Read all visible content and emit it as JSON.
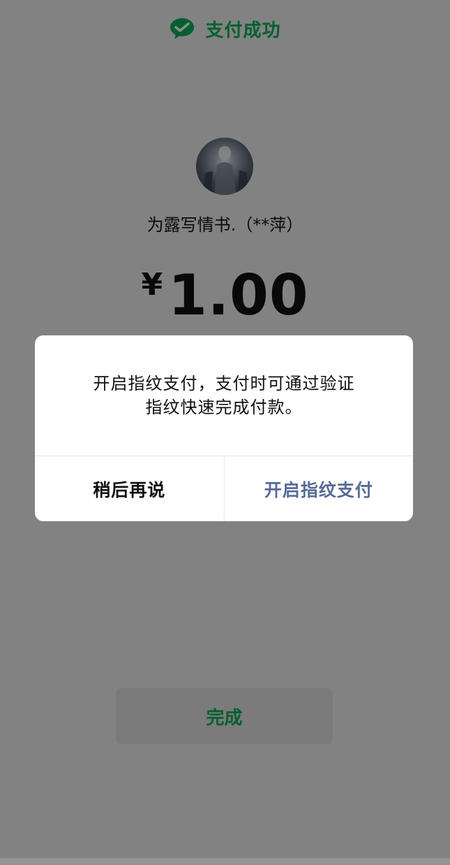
{
  "header": {
    "title": "支付成功",
    "icon": "wechat-logo-icon",
    "brand_color": "#06ae56"
  },
  "payment": {
    "payee": "为露写情书.（**萍）",
    "currency": "¥",
    "amount": "1.00"
  },
  "done_button": {
    "label": "完成"
  },
  "dialog": {
    "message_line1": "开启指纹支付，支付时可通过验证",
    "message_line2": "指纹快速完成付款。",
    "cancel_label": "稍后再说",
    "confirm_label": "开启指纹支付",
    "confirm_color": "#576b95"
  }
}
